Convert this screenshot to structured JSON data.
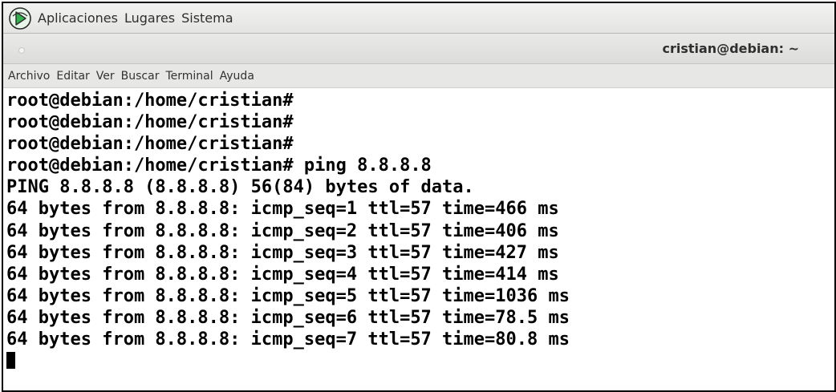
{
  "panel": {
    "menus": [
      "Aplicaciones",
      "Lugares",
      "Sistema"
    ]
  },
  "window": {
    "title": "cristian@debian: ~"
  },
  "menubar": {
    "items": [
      "Archivo",
      "Editar",
      "Ver",
      "Buscar",
      "Terminal",
      "Ayuda"
    ]
  },
  "terminal": {
    "lines": [
      "root@debian:/home/cristian#",
      "root@debian:/home/cristian#",
      "root@debian:/home/cristian#",
      "root@debian:/home/cristian# ping 8.8.8.8",
      "PING 8.8.8.8 (8.8.8.8) 56(84) bytes of data.",
      "64 bytes from 8.8.8.8: icmp_seq=1 ttl=57 time=466 ms",
      "64 bytes from 8.8.8.8: icmp_seq=2 ttl=57 time=406 ms",
      "64 bytes from 8.8.8.8: icmp_seq=3 ttl=57 time=427 ms",
      "64 bytes from 8.8.8.8: icmp_seq=4 ttl=57 time=414 ms",
      "64 bytes from 8.8.8.8: icmp_seq=5 ttl=57 time=1036 ms",
      "64 bytes from 8.8.8.8: icmp_seq=6 ttl=57 time=78.5 ms",
      "64 bytes from 8.8.8.8: icmp_seq=7 ttl=57 time=80.8 ms"
    ]
  },
  "colors": {
    "logo": "#2fb24b",
    "text": "#000000",
    "background": "#ffffff"
  },
  "icons": {
    "logo": "debian-logo-icon",
    "window_control": "window-menu-icon",
    "cursor": "block-cursor"
  }
}
